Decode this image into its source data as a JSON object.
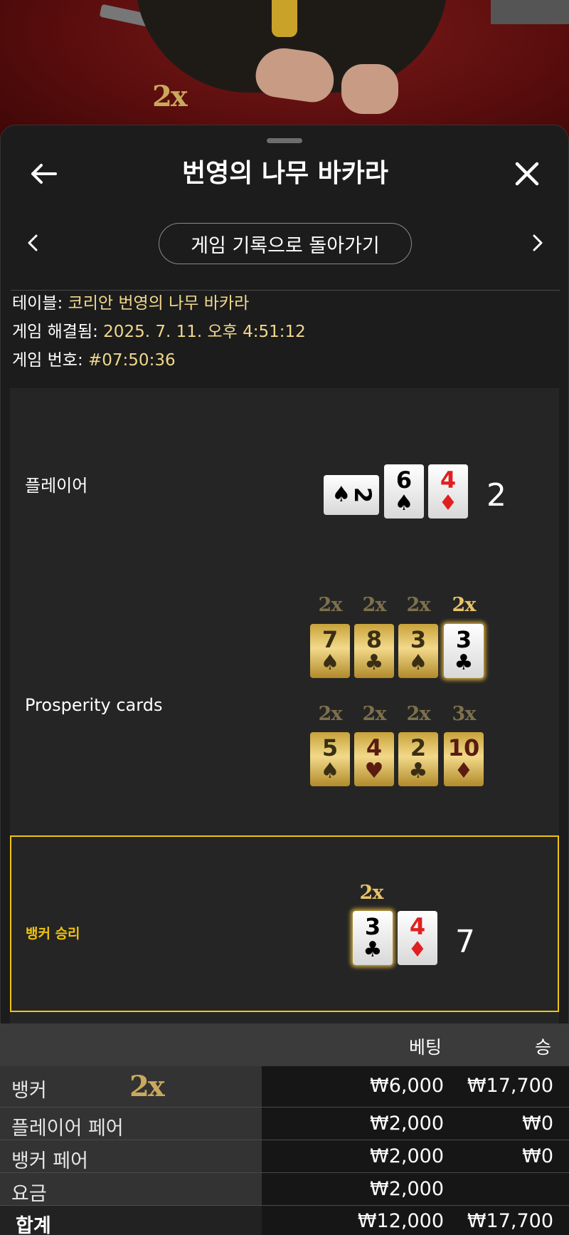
{
  "video": {
    "multiplier": "2x"
  },
  "header": {
    "title": "번영의 나무 바카라"
  },
  "nav": {
    "back_to_history": "게임 기록으로 돌아가기"
  },
  "info": {
    "table_label": "테이블: ",
    "table_value": "코리안 번영의 나무 바카라",
    "resolved_label": "게임 해결됨: ",
    "resolved_value": "2025. 7. 11. 오후 4:51:12",
    "game_no_label": "게임 번호: ",
    "game_no_value": "#07:50:36"
  },
  "result": {
    "player": {
      "label": "플레이어",
      "score": "2",
      "cards": [
        {
          "rank": "2",
          "suit": "♠",
          "color": "black",
          "sideways": true
        },
        {
          "rank": "6",
          "suit": "♠",
          "color": "black"
        },
        {
          "rank": "4",
          "suit": "♦",
          "color": "red"
        }
      ]
    },
    "prosperity": {
      "label": "Prosperity cards",
      "row1": [
        {
          "mult": "2x",
          "rank": "7",
          "suit": "♠",
          "color": "black",
          "highlight": false
        },
        {
          "mult": "2x",
          "rank": "8",
          "suit": "♣",
          "color": "black",
          "highlight": false
        },
        {
          "mult": "2x",
          "rank": "3",
          "suit": "♠",
          "color": "black",
          "highlight": false
        },
        {
          "mult": "2x",
          "rank": "3",
          "suit": "♣",
          "color": "black",
          "highlight": true
        }
      ],
      "row2": [
        {
          "mult": "2x",
          "rank": "5",
          "suit": "♠",
          "color": "black"
        },
        {
          "mult": "2x",
          "rank": "4",
          "suit": "♥",
          "color": "red"
        },
        {
          "mult": "2x",
          "rank": "2",
          "suit": "♣",
          "color": "black"
        },
        {
          "mult": "3x",
          "rank": "10",
          "suit": "♦",
          "color": "red"
        }
      ]
    },
    "banker": {
      "label": "뱅커 승리",
      "score": "7",
      "cards": [
        {
          "mult": "2x",
          "rank": "3",
          "suit": "♣",
          "color": "black",
          "highlight": true
        },
        {
          "rank": "4",
          "suit": "♦",
          "color": "red"
        }
      ]
    },
    "colors": {
      "win_border": "#f1c40f",
      "gold": "#c8a23a"
    }
  },
  "bets": {
    "headers": {
      "bet": "베팅",
      "win": "승"
    },
    "rows": [
      {
        "name": "뱅커",
        "mult": "2x",
        "bet": "₩6,000",
        "win": "₩17,700"
      },
      {
        "name": "플레이어 페어",
        "bet": "₩2,000",
        "win": "₩0"
      },
      {
        "name": "뱅커 페어",
        "bet": "₩2,000",
        "win": "₩0"
      },
      {
        "name": "요금",
        "bet": "₩2,000",
        "win": ""
      }
    ],
    "total": {
      "name": "합계",
      "bet": "₩12,000",
      "win": "₩17,700"
    }
  }
}
